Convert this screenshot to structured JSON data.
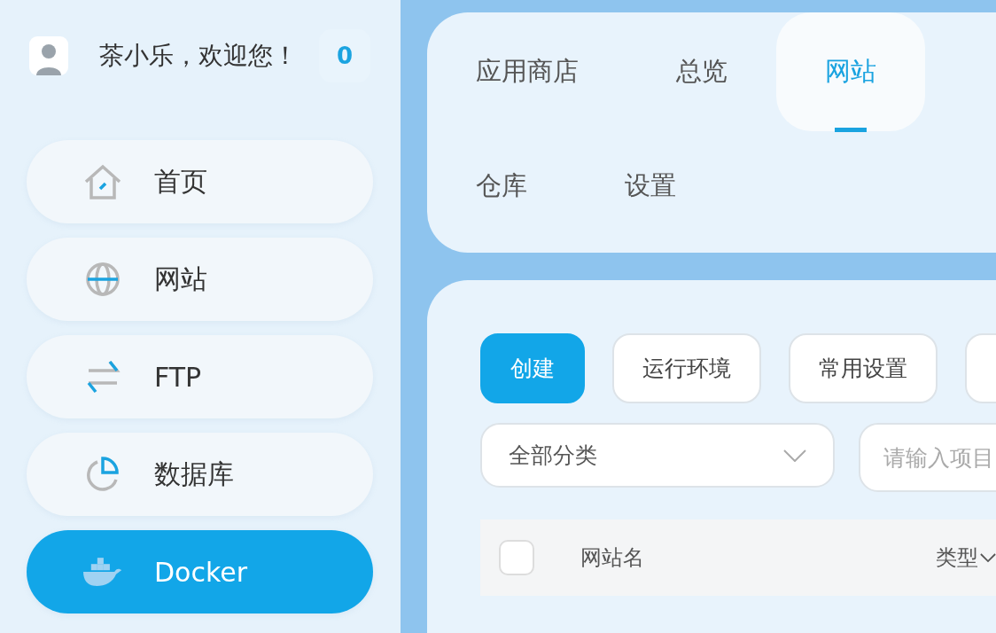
{
  "sidebar": {
    "user": {
      "greeting": "茶小乐，欢迎您！",
      "badge": "0"
    },
    "items": [
      {
        "label": "首页",
        "kind": "home",
        "selected": false
      },
      {
        "label": "网站",
        "kind": "globe",
        "selected": false
      },
      {
        "label": "FTP",
        "kind": "transfer",
        "selected": false
      },
      {
        "label": "数据库",
        "kind": "database",
        "selected": false
      },
      {
        "label": "Docker",
        "kind": "docker",
        "selected": true
      }
    ]
  },
  "tabs": [
    {
      "label": "应用商店",
      "selected": false
    },
    {
      "label": "总览",
      "selected": false
    },
    {
      "label": "网站",
      "selected": true
    },
    {
      "label": "仓库",
      "selected": false
    },
    {
      "label": "设置",
      "selected": false
    }
  ],
  "toolbar": {
    "buttons": [
      {
        "label": "创建",
        "kind": "primary"
      },
      {
        "label": "运行环境",
        "kind": "default"
      },
      {
        "label": "常用设置",
        "kind": "default"
      },
      {
        "kind": "partial"
      }
    ],
    "category_select": {
      "value": "全部分类"
    },
    "search": {
      "placeholder": "请输入项目"
    }
  },
  "table": {
    "select_all": {
      "checked": false
    },
    "columns": [
      {
        "label": "网站名",
        "sortable": false
      },
      {
        "label": "类型",
        "sortable": true
      }
    ]
  }
}
